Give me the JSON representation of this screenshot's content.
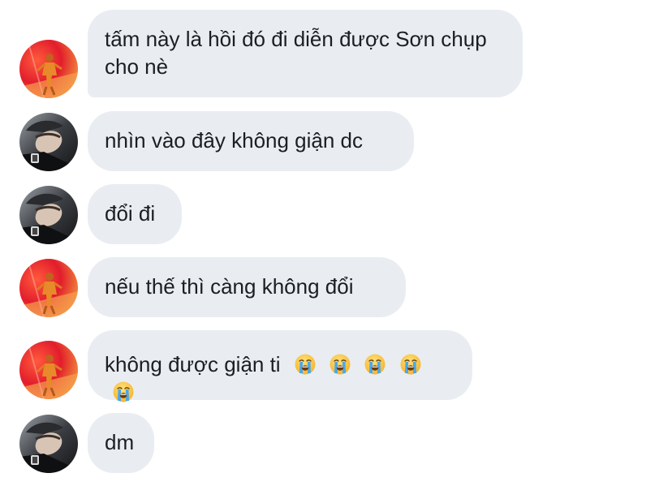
{
  "messages": [
    {
      "sender": "orange-avatar",
      "text": "tấm này là hồi đó đi diễn được Sơn chụp cho nè"
    },
    {
      "sender": "dark-avatar",
      "text": "nhìn vào đây không giận dc"
    },
    {
      "sender": "dark-avatar",
      "text": "đổi đi"
    },
    {
      "sender": "orange-avatar",
      "text": "nếu thế thì càng không đổi"
    },
    {
      "sender": "orange-avatar",
      "text": "không được giận ti",
      "emojis": [
        "loudly-crying-face",
        "loudly-crying-face",
        "loudly-crying-face",
        "loudly-crying-face",
        "loudly-crying-face"
      ]
    },
    {
      "sender": "dark-avatar",
      "text": "dm"
    }
  ],
  "colors": {
    "bubble_bg": "#e9edf1",
    "text": "#1c1e21",
    "background": "#ffffff"
  }
}
